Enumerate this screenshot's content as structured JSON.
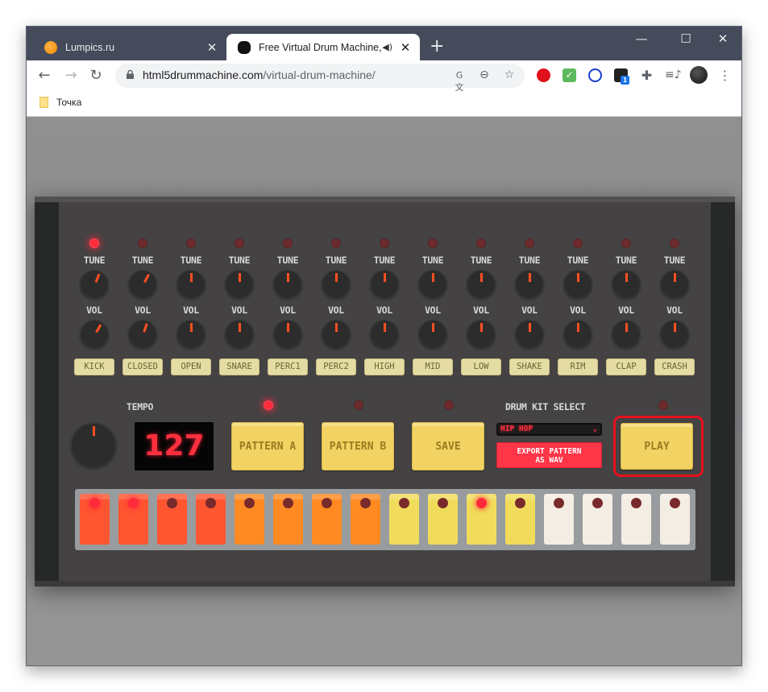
{
  "browser": {
    "tabs": [
      {
        "title": "Lumpics.ru",
        "active": false,
        "icon": "orange-favicon"
      },
      {
        "title": "Free Virtual Drum Machine, U",
        "active": true,
        "icon": "drum-favicon",
        "audio": true
      }
    ],
    "new_tab": "+",
    "window_controls": {
      "minimize": "—",
      "maximize": "☐",
      "close": "✕"
    },
    "nav": {
      "back": "←",
      "forward": "→",
      "reload": "↻"
    },
    "url_host": "html5drummachine.com",
    "url_path": "/virtual-drum-machine/",
    "omnibox_icons": [
      "translate-icon",
      "zoom-icon",
      "star-icon"
    ],
    "extensions": [
      "adblock-icon",
      "checkmark-extension-icon",
      "globe-extension-icon",
      "box-extension-icon",
      "puzzle-icon",
      "media-icon",
      "profile-avatar",
      "menu-icon"
    ],
    "extension_badge": "1",
    "bookmarks": [
      {
        "label": "Точка"
      }
    ]
  },
  "drum_machine": {
    "channels": [
      {
        "name": "KICK",
        "tune_label": "TUNE",
        "vol_label": "VOL",
        "tune_angle_deg": 22,
        "vol_angle_deg": 30,
        "led_on": true
      },
      {
        "name": "CLOSED",
        "tune_label": "TUNE",
        "vol_label": "VOL",
        "tune_angle_deg": 28,
        "vol_angle_deg": 18,
        "led_on": false
      },
      {
        "name": "OPEN",
        "tune_label": "TUNE",
        "vol_label": "VOL",
        "tune_angle_deg": 0,
        "vol_angle_deg": 0,
        "led_on": false
      },
      {
        "name": "SNARE",
        "tune_label": "TUNE",
        "vol_label": "VOL",
        "tune_angle_deg": 0,
        "vol_angle_deg": 0,
        "led_on": false
      },
      {
        "name": "PERC1",
        "tune_label": "TUNE",
        "vol_label": "VOL",
        "tune_angle_deg": 0,
        "vol_angle_deg": 0,
        "led_on": false
      },
      {
        "name": "PERC2",
        "tune_label": "TUNE",
        "vol_label": "VOL",
        "tune_angle_deg": 0,
        "vol_angle_deg": 0,
        "led_on": false
      },
      {
        "name": "HIGH",
        "tune_label": "TUNE",
        "vol_label": "VOL",
        "tune_angle_deg": 0,
        "vol_angle_deg": 0,
        "led_on": false
      },
      {
        "name": "MID",
        "tune_label": "TUNE",
        "vol_label": "VOL",
        "tune_angle_deg": 0,
        "vol_angle_deg": 0,
        "led_on": false
      },
      {
        "name": "LOW",
        "tune_label": "TUNE",
        "vol_label": "VOL",
        "tune_angle_deg": 0,
        "vol_angle_deg": 0,
        "led_on": false
      },
      {
        "name": "SHAKE",
        "tune_label": "TUNE",
        "vol_label": "VOL",
        "tune_angle_deg": 0,
        "vol_angle_deg": 0,
        "led_on": false
      },
      {
        "name": "RIM",
        "tune_label": "TUNE",
        "vol_label": "VOL",
        "tune_angle_deg": 0,
        "vol_angle_deg": 0,
        "led_on": false
      },
      {
        "name": "CLAP",
        "tune_label": "TUNE",
        "vol_label": "VOL",
        "tune_angle_deg": 0,
        "vol_angle_deg": 0,
        "led_on": false
      },
      {
        "name": "CRASH",
        "tune_label": "TUNE",
        "vol_label": "VOL",
        "tune_angle_deg": 0,
        "vol_angle_deg": 0,
        "led_on": false
      }
    ],
    "tempo_label": "TEMPO",
    "tempo_value": "127",
    "pattern_a": {
      "label": "PATTERN A",
      "led_on": true
    },
    "pattern_b": {
      "label": "PATTERN B",
      "led_on": false
    },
    "save": {
      "label": "SAVE",
      "led_on": false
    },
    "kit_select_label": "DRUM KIT SELECT",
    "kit_selected": "HIP HOP",
    "export_label_line1": "EXPORT PATTERN",
    "export_label_line2": "AS WAV",
    "play": {
      "label": "PLAY",
      "led_on": false,
      "highlighted": true
    },
    "steps": [
      {
        "color": "#ff5530",
        "on": true
      },
      {
        "color": "#ff5530",
        "on": true
      },
      {
        "color": "#ff5530",
        "on": false
      },
      {
        "color": "#ff5530",
        "on": false
      },
      {
        "color": "#ff8a22",
        "on": false
      },
      {
        "color": "#ff8a22",
        "on": false
      },
      {
        "color": "#ff8a22",
        "on": false
      },
      {
        "color": "#ff8a22",
        "on": false
      },
      {
        "color": "#f0dc5a",
        "on": false
      },
      {
        "color": "#f0dc5a",
        "on": false
      },
      {
        "color": "#f0dc5a",
        "on": true
      },
      {
        "color": "#f0dc5a",
        "on": false
      },
      {
        "color": "#f3ede3",
        "on": false
      },
      {
        "color": "#f3ede3",
        "on": false
      },
      {
        "color": "#f3ede3",
        "on": false
      },
      {
        "color": "#f3ede3",
        "on": false
      }
    ],
    "colors": {
      "accent_red": "#ff2a3a",
      "button_yellow": "#f1d262",
      "panel": "#444243"
    }
  }
}
